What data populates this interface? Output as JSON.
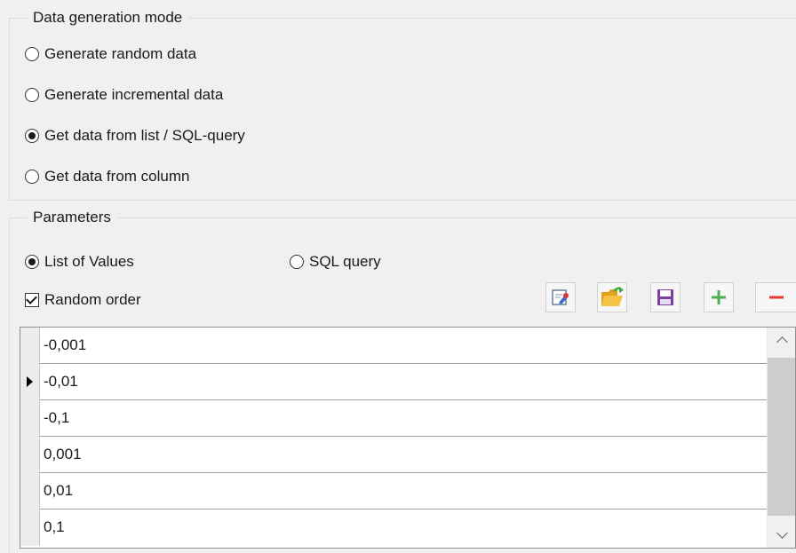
{
  "mode_group": {
    "title": "Data generation mode",
    "options": [
      {
        "label": "Generate random data",
        "checked": false
      },
      {
        "label": "Generate incremental data",
        "checked": false
      },
      {
        "label": "Get data from list / SQL-query",
        "checked": true
      },
      {
        "label": "Get data from column",
        "checked": false
      }
    ]
  },
  "params_group": {
    "title": "Parameters",
    "source_options": [
      {
        "label": "List of Values",
        "checked": true
      },
      {
        "label": "SQL query",
        "checked": false
      }
    ],
    "random_order": {
      "label": "Random order",
      "checked": true
    },
    "toolbar_icons": [
      "edit-icon",
      "open-folder-icon",
      "save-icon",
      "add-icon",
      "remove-icon"
    ]
  },
  "values_grid": {
    "rows": [
      "-0,001",
      "-0,01",
      "-0,1",
      "0,001",
      "0,01",
      "0,1"
    ],
    "current_row": 1
  },
  "colors": {
    "add": "#4caf50",
    "remove": "#e53935",
    "save": "#7b3fa0",
    "folder": "#f0b429"
  }
}
